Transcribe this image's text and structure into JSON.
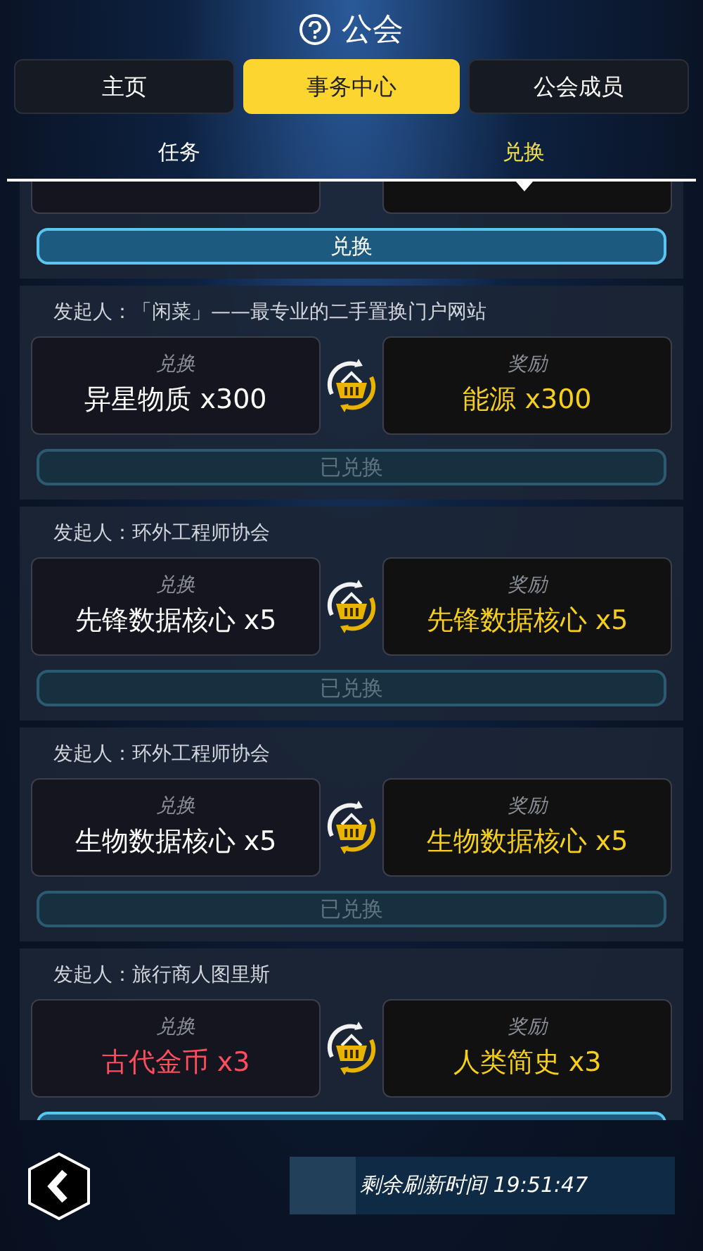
{
  "header": {
    "title": "公会"
  },
  "tabs": [
    {
      "label": "主页",
      "selected": false
    },
    {
      "label": "事务中心",
      "selected": true
    },
    {
      "label": "公会成员",
      "selected": false
    }
  ],
  "subtabs": [
    {
      "label": "任务",
      "selected": false
    },
    {
      "label": "兑换",
      "selected": true
    }
  ],
  "trades": [
    {
      "redeemed": false,
      "button": "兑换"
    },
    {
      "sponsor": "发起人：「闲菜」——最专业的二手置换门户网站",
      "give_label": "兑换",
      "give": "异星物质 x300",
      "color": "#ffffff",
      "reward_label": "奖励",
      "reward": "能源 x300",
      "redeemed": true,
      "button": "已兑换"
    },
    {
      "sponsor": "发起人：环外工程师协会",
      "give_label": "兑换",
      "give": "先锋数据核心 x5",
      "color": "#ffffff",
      "reward_label": "奖励",
      "reward": "先锋数据核心 x5",
      "redeemed": true,
      "button": "已兑换"
    },
    {
      "sponsor": "发起人：环外工程师协会",
      "give_label": "兑换",
      "give": "生物数据核心 x5",
      "color": "#ffffff",
      "reward_label": "奖励",
      "reward": "生物数据核心 x5",
      "redeemed": true,
      "button": "已兑换"
    },
    {
      "sponsor": "发起人：旅行商人图里斯",
      "give_label": "兑换",
      "give": "古代金币 x3",
      "color": "#ff4d5e",
      "reward_label": "奖励",
      "reward": "人类简史 x3",
      "redeemed": false
    }
  ],
  "footer": {
    "refresh": "剩余刷新时间 19:51:47"
  }
}
